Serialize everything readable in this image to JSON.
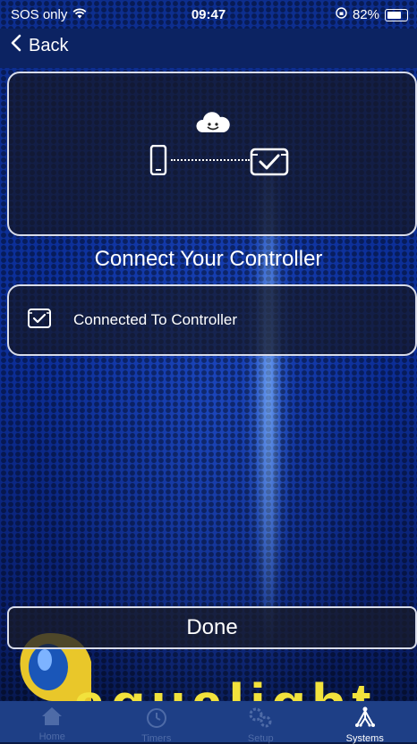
{
  "status_bar": {
    "carrier": "SOS only",
    "time": "09:47",
    "battery": "82%",
    "battery_level": 0.82
  },
  "nav": {
    "back_label": "Back"
  },
  "hero": {
    "icons": [
      "cloud-icon",
      "phone-icon",
      "controller-icon"
    ]
  },
  "main": {
    "heading": "Connect Your Controller",
    "connection_status": "Connected To Controller",
    "done_label": "Done"
  },
  "brand": {
    "logo_text": "aqualight"
  },
  "tabs": [
    {
      "label": "Home",
      "icon": "home-icon",
      "active": false
    },
    {
      "label": "Timers",
      "icon": "timer-icon",
      "active": false
    },
    {
      "label": "Setup",
      "icon": "gears-icon",
      "active": false
    },
    {
      "label": "Systems",
      "icon": "systems-icon",
      "active": true
    }
  ],
  "colors": {
    "accent_yellow": "#f2e23c",
    "panel_border": "#d8dcea",
    "tabbar_bg": "#1e3f86"
  }
}
